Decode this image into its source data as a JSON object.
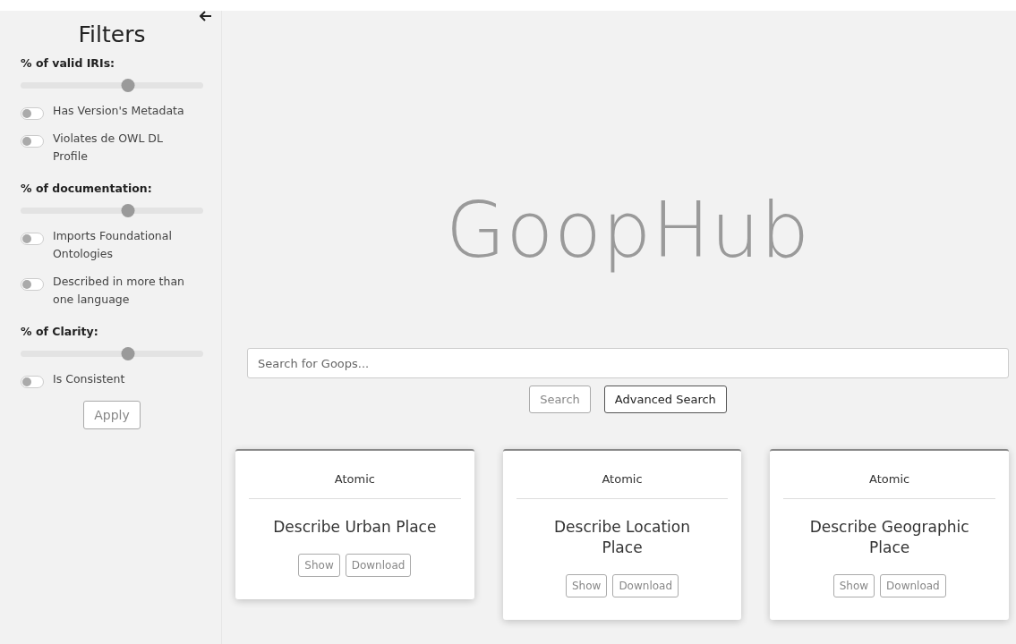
{
  "sidebar": {
    "title": "Filters",
    "filters": [
      {
        "kind": "slider",
        "label": "% of valid IRIs:",
        "level": 0.59
      },
      {
        "kind": "toggle",
        "label": "Has Version's Metadata",
        "on": false
      },
      {
        "kind": "toggle",
        "label": "Violates de OWL DL Profile",
        "on": false
      },
      {
        "kind": "slider",
        "label": "% of documentation:",
        "level": 0.59
      },
      {
        "kind": "toggle",
        "label": "Imports Foundational Ontologies",
        "on": false
      },
      {
        "kind": "toggle",
        "label": "Described in more than one language",
        "on": false
      },
      {
        "kind": "slider",
        "label": "% of Clarity:",
        "level": 0.59
      },
      {
        "kind": "toggle",
        "label": "Is Consistent",
        "on": false
      }
    ],
    "apply_button": {
      "label": "Apply",
      "disabled": true
    }
  },
  "main": {
    "logo": "GoopHub",
    "search": {
      "placeholder": "Search for Goops..."
    },
    "buttons": [
      {
        "label": "Search",
        "disabled": true
      },
      {
        "label": "Advanced Search",
        "disabled": false
      }
    ],
    "cards": [
      {
        "category": "Atomic",
        "title": "Describe Urban Place",
        "actions": [
          "Show",
          "Download"
        ]
      },
      {
        "category": "Atomic",
        "title": "Describe Location Place",
        "actions": [
          "Show",
          "Download"
        ]
      },
      {
        "category": "Atomic",
        "title": "Describe Geographic Place",
        "actions": [
          "Show",
          "Download"
        ]
      }
    ]
  }
}
